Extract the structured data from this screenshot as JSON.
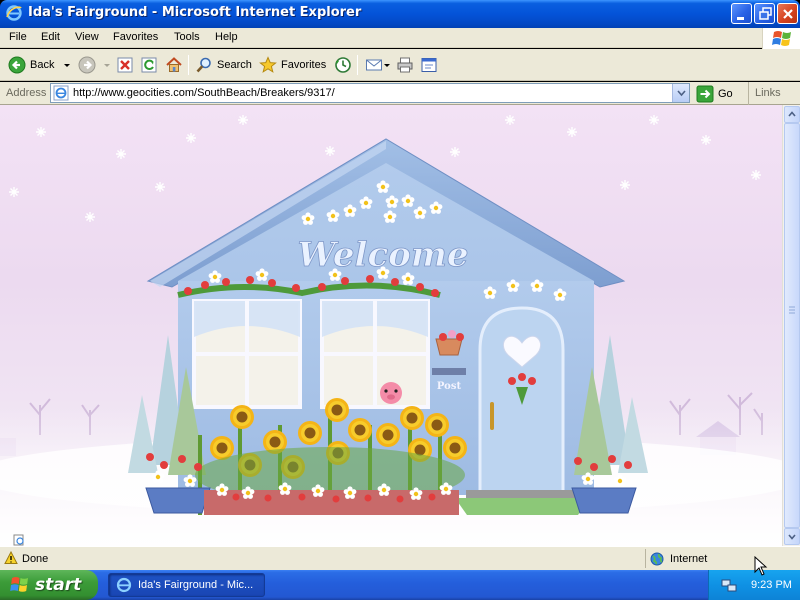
{
  "window": {
    "title": "Ida's Fairground - Microsoft Internet Explorer"
  },
  "menu": {
    "items": [
      "File",
      "Edit",
      "View",
      "Favorites",
      "Tools",
      "Help"
    ]
  },
  "toolbar": {
    "back_label": "Back",
    "search_label": "Search",
    "favorites_label": "Favorites"
  },
  "address": {
    "label": "Address",
    "url": "http://www.geocities.com/SouthBeach/Breakers/9317/",
    "go_label": "Go",
    "links_label": "Links"
  },
  "page": {
    "welcome_text": "Welcome",
    "mailbox_text": "Post"
  },
  "status": {
    "text": "Done",
    "zone": "Internet"
  },
  "taskbar": {
    "start_label": "start",
    "task_label": "Ida's Fairground - Mic...",
    "clock": "9:23 PM"
  },
  "colors": {
    "titlebar": "#0453d8",
    "start": "#3c9c39",
    "house": "#a8c4e8",
    "roof": "#8fb0dc",
    "sky": "#ecdaf0"
  }
}
